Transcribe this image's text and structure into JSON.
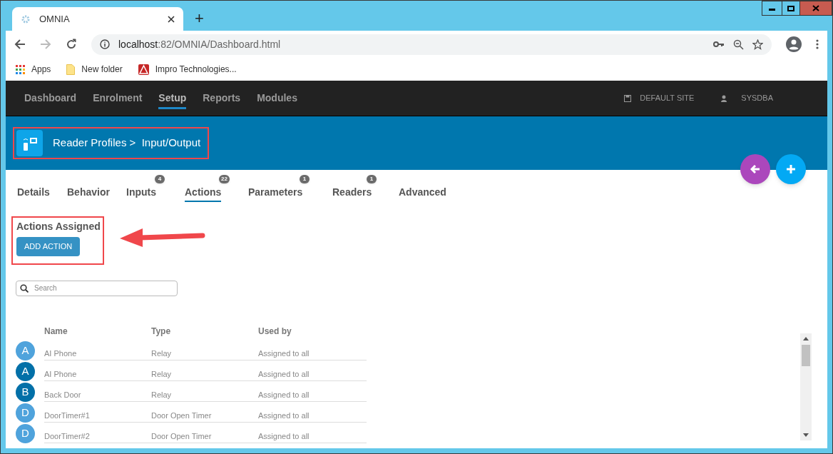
{
  "browser": {
    "tab_title": "OMNIA",
    "new_tab": "+",
    "url_host": "localhost",
    "url_path": ":82/OMNIA/Dashboard.html",
    "bookmarks": [
      {
        "kind": "apps",
        "label": "Apps"
      },
      {
        "kind": "folder",
        "label": "New folder"
      },
      {
        "kind": "site",
        "label": "Impro Technologies..."
      }
    ]
  },
  "nav": {
    "items": [
      {
        "label": "Dashboard",
        "selected": false
      },
      {
        "label": "Enrolment",
        "selected": false
      },
      {
        "label": "Setup",
        "selected": true
      },
      {
        "label": "Reports",
        "selected": false
      },
      {
        "label": "Modules",
        "selected": false
      }
    ],
    "site": "DEFAULT SITE",
    "user": "SYSDBA"
  },
  "header": {
    "breadcrumb": "Reader Profiles >  Input/Output"
  },
  "tabs": [
    {
      "label": "Details",
      "selected": false
    },
    {
      "label": "Behavior",
      "selected": false
    },
    {
      "label": "Inputs",
      "badge": "4",
      "selected": false
    },
    {
      "label": "Actions",
      "badge": "22",
      "selected": true
    },
    {
      "label": "Parameters",
      "badge": "1",
      "selected": false
    },
    {
      "label": "Readers",
      "badge": "1",
      "selected": false
    },
    {
      "label": "Advanced",
      "selected": false
    }
  ],
  "section_title": "Actions Assigned",
  "add_button": "ADD ACTION",
  "search": {
    "placeholder": "Search"
  },
  "table": {
    "columns": [
      "Name",
      "Type",
      "Used by"
    ],
    "rows": [
      {
        "initial": "A",
        "color": "#4fa3dc",
        "name": "AI Phone",
        "type": "Relay",
        "used_by": "Assigned to all"
      },
      {
        "initial": "A",
        "color": "#0270a8",
        "name": "AI Phone",
        "type": "Relay",
        "used_by": "Assigned to all"
      },
      {
        "initial": "B",
        "color": "#0270a8",
        "name": "Back Door",
        "type": "Relay",
        "used_by": "Assigned to all"
      },
      {
        "initial": "D",
        "color": "#4fa3dc",
        "name": "DoorTimer#1",
        "type": "Door Open Timer",
        "used_by": "Assigned to all"
      },
      {
        "initial": "D",
        "color": "#4fa3dc",
        "name": "DoorTimer#2",
        "type": "Door Open Timer",
        "used_by": "Assigned to all"
      }
    ]
  }
}
